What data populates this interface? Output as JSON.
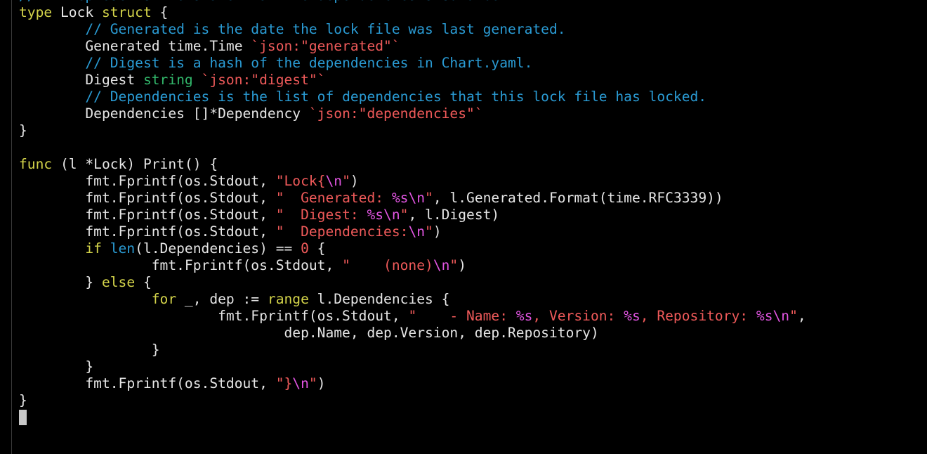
{
  "colors": {
    "background": "#000000",
    "plain": "#e6e6e6",
    "keyword": "#d4d44a",
    "type": "#32b86b",
    "comment": "#2a9bd4",
    "string": "#f05a5a",
    "format_verb": "#e255e2",
    "cursor": "#c8c8c8"
  },
  "editor": {
    "lines": [
      [
        {
          "t": "comment",
          "v": "// It represents the state that the dependencies should be in."
        }
      ],
      [
        {
          "t": "keyword",
          "v": "type"
        },
        {
          "t": "plain",
          "v": " Lock "
        },
        {
          "t": "keyword",
          "v": "struct"
        },
        {
          "t": "plain",
          "v": " {"
        }
      ],
      [
        {
          "t": "plain",
          "v": "        "
        },
        {
          "t": "comment",
          "v": "// Generated is the date the lock file was last generated."
        }
      ],
      [
        {
          "t": "plain",
          "v": "        Generated time.Time "
        },
        {
          "t": "string",
          "v": "`json:\"generated\"`"
        }
      ],
      [
        {
          "t": "plain",
          "v": "        "
        },
        {
          "t": "comment",
          "v": "// Digest is a hash of the dependencies in Chart.yaml."
        }
      ],
      [
        {
          "t": "plain",
          "v": "        Digest "
        },
        {
          "t": "type",
          "v": "string"
        },
        {
          "t": "plain",
          "v": " "
        },
        {
          "t": "string",
          "v": "`json:\"digest\"`"
        }
      ],
      [
        {
          "t": "plain",
          "v": "        "
        },
        {
          "t": "comment",
          "v": "// Dependencies is the list of dependencies that this lock file has locked."
        }
      ],
      [
        {
          "t": "plain",
          "v": "        Dependencies []*Dependency "
        },
        {
          "t": "string",
          "v": "`json:\"dependencies\"`"
        }
      ],
      [
        {
          "t": "plain",
          "v": "}"
        }
      ],
      [],
      [
        {
          "t": "keyword",
          "v": "func"
        },
        {
          "t": "plain",
          "v": " (l *Lock) Print() {"
        }
      ],
      [
        {
          "t": "plain",
          "v": "        fmt.Fprintf(os.Stdout, "
        },
        {
          "t": "string",
          "v": "\"Lock{"
        },
        {
          "t": "fmt",
          "v": "\\n"
        },
        {
          "t": "string",
          "v": "\""
        },
        {
          "t": "plain",
          "v": ")"
        }
      ],
      [
        {
          "t": "plain",
          "v": "        fmt.Fprintf(os.Stdout, "
        },
        {
          "t": "string",
          "v": "\"  Generated: "
        },
        {
          "t": "fmt",
          "v": "%s\\n"
        },
        {
          "t": "string",
          "v": "\""
        },
        {
          "t": "plain",
          "v": ", l.Generated.Format(time.RFC3339))"
        }
      ],
      [
        {
          "t": "plain",
          "v": "        fmt.Fprintf(os.Stdout, "
        },
        {
          "t": "string",
          "v": "\"  Digest: "
        },
        {
          "t": "fmt",
          "v": "%s\\n"
        },
        {
          "t": "string",
          "v": "\""
        },
        {
          "t": "plain",
          "v": ", l.Digest)"
        }
      ],
      [
        {
          "t": "plain",
          "v": "        fmt.Fprintf(os.Stdout, "
        },
        {
          "t": "string",
          "v": "\"  Dependencies:"
        },
        {
          "t": "fmt",
          "v": "\\n"
        },
        {
          "t": "string",
          "v": "\""
        },
        {
          "t": "plain",
          "v": ")"
        }
      ],
      [
        {
          "t": "plain",
          "v": "        "
        },
        {
          "t": "keyword",
          "v": "if"
        },
        {
          "t": "plain",
          "v": " "
        },
        {
          "t": "comment",
          "v": "len"
        },
        {
          "t": "plain",
          "v": "(l.Dependencies) == "
        },
        {
          "t": "string",
          "v": "0"
        },
        {
          "t": "plain",
          "v": " {"
        }
      ],
      [
        {
          "t": "plain",
          "v": "                fmt.Fprintf(os.Stdout, "
        },
        {
          "t": "string",
          "v": "\"    (none)"
        },
        {
          "t": "fmt",
          "v": "\\n"
        },
        {
          "t": "string",
          "v": "\""
        },
        {
          "t": "plain",
          "v": ")"
        }
      ],
      [
        {
          "t": "plain",
          "v": "        } "
        },
        {
          "t": "keyword",
          "v": "else"
        },
        {
          "t": "plain",
          "v": " {"
        }
      ],
      [
        {
          "t": "plain",
          "v": "                "
        },
        {
          "t": "keyword",
          "v": "for"
        },
        {
          "t": "plain",
          "v": " _, dep := "
        },
        {
          "t": "keyword",
          "v": "range"
        },
        {
          "t": "plain",
          "v": " l.Dependencies {"
        }
      ],
      [
        {
          "t": "plain",
          "v": "                        fmt.Fprintf(os.Stdout, "
        },
        {
          "t": "string",
          "v": "\"    - Name: "
        },
        {
          "t": "fmt",
          "v": "%s"
        },
        {
          "t": "string",
          "v": ", Version: "
        },
        {
          "t": "fmt",
          "v": "%s"
        },
        {
          "t": "string",
          "v": ", Repository: "
        },
        {
          "t": "fmt",
          "v": "%s\\n"
        },
        {
          "t": "string",
          "v": "\""
        },
        {
          "t": "plain",
          "v": ","
        }
      ],
      [
        {
          "t": "plain",
          "v": "                                dep.Name, dep.Version, dep.Repository)"
        }
      ],
      [
        {
          "t": "plain",
          "v": "                }"
        }
      ],
      [
        {
          "t": "plain",
          "v": "        }"
        }
      ],
      [
        {
          "t": "plain",
          "v": "        fmt.Fprintf(os.Stdout, "
        },
        {
          "t": "string",
          "v": "\"}"
        },
        {
          "t": "fmt",
          "v": "\\n"
        },
        {
          "t": "string",
          "v": "\""
        },
        {
          "t": "plain",
          "v": ")"
        }
      ],
      [
        {
          "t": "plain",
          "v": "}"
        }
      ],
      [
        {
          "t": "cursor",
          "v": ""
        }
      ]
    ]
  }
}
